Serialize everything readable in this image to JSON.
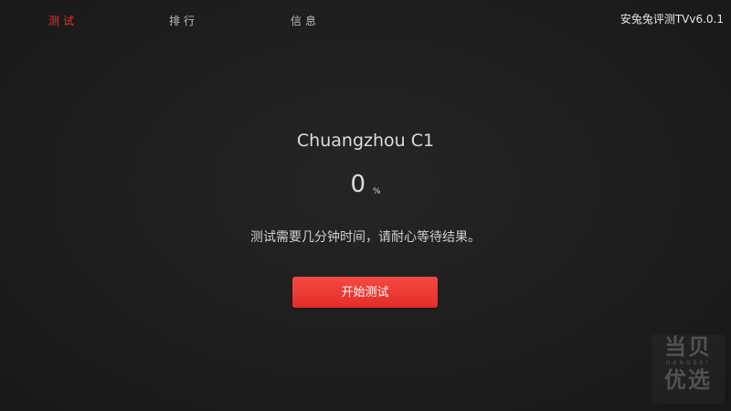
{
  "tabs": [
    {
      "label": "测试",
      "active": true
    },
    {
      "label": "排行",
      "active": false
    },
    {
      "label": "信息",
      "active": false
    }
  ],
  "app_version": "安兔兔评测TVv6.0.1",
  "device_name": "Chuangzhou C1",
  "progress": {
    "value": "0",
    "unit": "%"
  },
  "hint": "测试需要几分钟时间，请耐心等待结果。",
  "start_button": {
    "label": "开始测试"
  },
  "watermark": {
    "top": "当贝",
    "middle": "DANGBEI",
    "bottom": "优选"
  },
  "colors": {
    "accent": "#e8322c",
    "button": "#f03a35",
    "background": "#1f1f1f"
  }
}
